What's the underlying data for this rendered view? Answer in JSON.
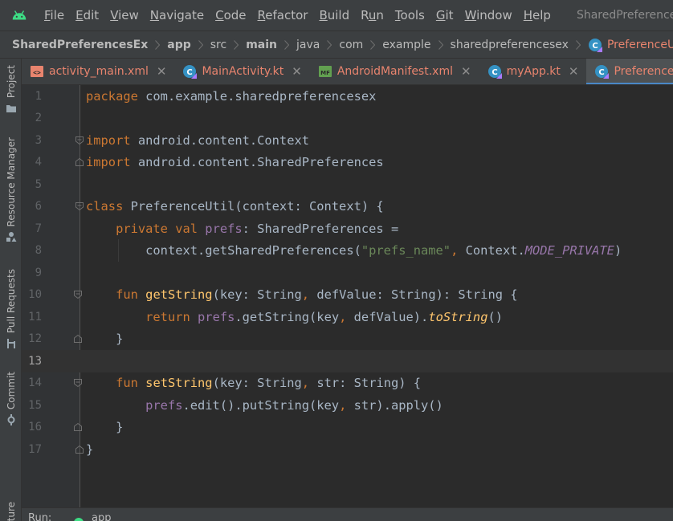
{
  "menubar": {
    "logo_icon": "android-logo-icon",
    "items": [
      "File",
      "Edit",
      "View",
      "Navigate",
      "Code",
      "Refactor",
      "Build",
      "Run",
      "Tools",
      "Git",
      "Window",
      "Help"
    ],
    "mnemonics": [
      "F",
      "E",
      "V",
      "N",
      "C",
      "R",
      "B",
      "u",
      "T",
      "G",
      "W",
      "H"
    ],
    "title": "SharedPreferencesEx"
  },
  "breadcrumb": {
    "items": [
      "SharedPreferencesEx",
      "app",
      "src",
      "main",
      "java",
      "com",
      "example",
      "sharedpreferencesex",
      "PreferenceUtil"
    ],
    "class_icon": "kotlin-class-icon"
  },
  "tool_windows": {
    "project": "Project",
    "resource_manager": "Resource Manager",
    "pull_requests": "Pull Requests",
    "commit": "Commit",
    "structure": "Structure"
  },
  "tabs": [
    {
      "label": "activity_main.xml",
      "icon": "xml-file-icon"
    },
    {
      "label": "MainActivity.kt",
      "icon": "kotlin-class-icon"
    },
    {
      "label": "AndroidManifest.xml",
      "icon": "manifest-file-icon"
    },
    {
      "label": "myApp.kt",
      "icon": "kotlin-class-icon"
    },
    {
      "label": "PreferenceUtil.kt",
      "icon": "kotlin-class-icon"
    }
  ],
  "close_glyph": "✕",
  "editor": {
    "line_numbers": [
      "1",
      "2",
      "3",
      "4",
      "5",
      "6",
      "7",
      "8",
      "9",
      "10",
      "11",
      "12",
      "13",
      "14",
      "15",
      "16",
      "17"
    ],
    "current_line": 13,
    "code": {
      "l1_kw": "package",
      "l1_rest": " com.example.sharedpreferencesex",
      "l3_kw": "import",
      "l3_rest": " android.content.Context",
      "l4_kw": "import",
      "l4_rest": " android.content.SharedPreferences",
      "l6_kw": "class",
      "l6_rest": " PreferenceUtil(context: Context) {",
      "l7_kw": "private val",
      "l7_prop": "prefs",
      "l7_rest": ": SharedPreferences =",
      "l8_a": "context.getSharedPreferences(",
      "l8_str": "\"prefs_name\"",
      "l8_comma": ",",
      "l8_b": " Context.",
      "l8_const": "MODE_PRIVATE",
      "l8_end": ")",
      "l10_kw": "fun",
      "l10_fn": "getString",
      "l10_a": "(key: String",
      "l10_comma": ",",
      "l10_b": " defValue: String): String {",
      "l11_kw": "return",
      "l11_prop": "prefs",
      "l11_a": ".getString(key",
      "l11_comma": ",",
      "l11_b": " defValue).",
      "l11_ext": "toString",
      "l11_end": "()",
      "l12": "}",
      "l14_kw": "fun",
      "l14_fn": "setString",
      "l14_a": "(key: String",
      "l14_comma": ",",
      "l14_b": " str: String) {",
      "l15_prop": "prefs",
      "l15_a": ".edit().putString(key",
      "l15_comma": ",",
      "l15_b": " str).apply()",
      "l16": "}",
      "l17": "}"
    }
  },
  "bottombar": {
    "run_label": "Run:",
    "app_label": "app"
  },
  "colors": {
    "keyword": "#cc7832",
    "function": "#ffc66d",
    "string": "#6a8759",
    "property": "#9876aa",
    "tab_accent": "#4a88c7"
  }
}
